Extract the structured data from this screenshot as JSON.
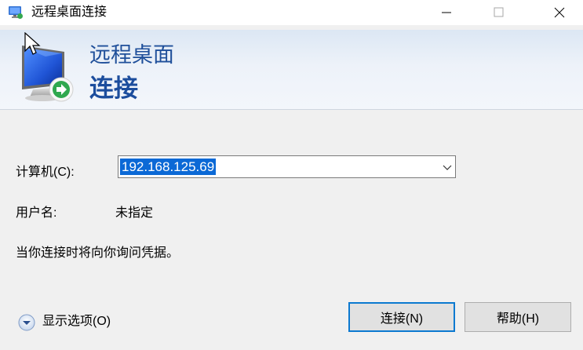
{
  "window": {
    "title": "远程桌面连接",
    "controls": {
      "minimize": "minimize-icon",
      "maximize": "maximize-icon",
      "close": "close-icon"
    }
  },
  "banner": {
    "title_line1": "远程桌面",
    "title_line2": "连接",
    "icon": "remote-desktop-monitor-icon",
    "title_color": "#1c4d9d"
  },
  "form": {
    "computer_label": "计算机(C):",
    "computer_value": "192.168.125.69",
    "user_label": "用户名:",
    "user_value": "未指定",
    "info_text": "当你连接时将向你询问凭据。"
  },
  "footer": {
    "show_options_label": "显示选项(O)",
    "connect_label": "连接(N)",
    "help_label": "帮助(H)"
  },
  "colors": {
    "selection": "#0b69d6",
    "default_button_border": "#0b79d0",
    "background": "#f0f0f0"
  }
}
